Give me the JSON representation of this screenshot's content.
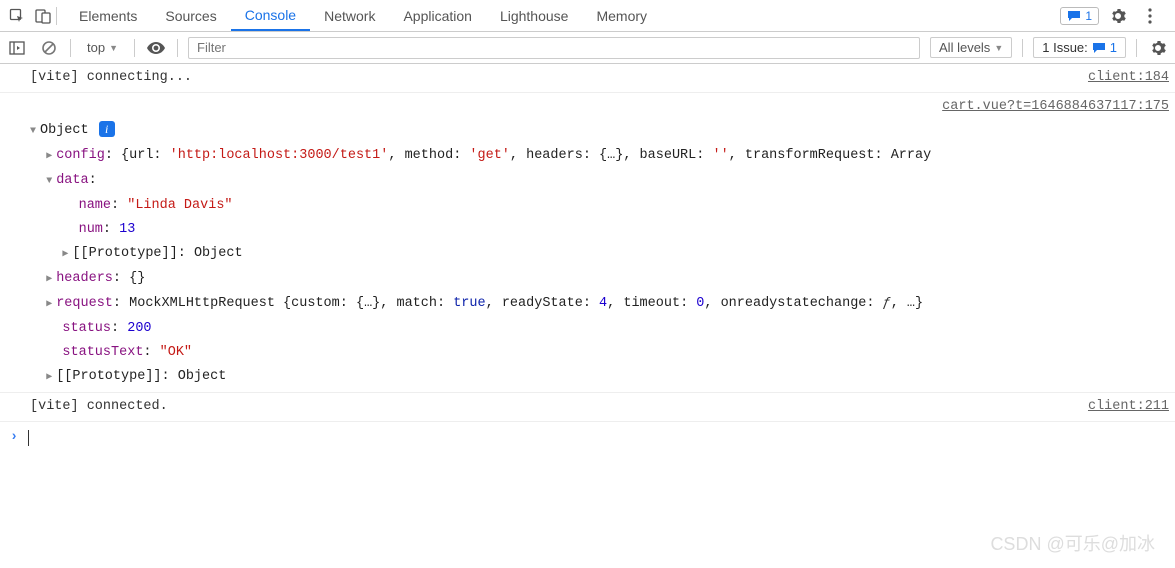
{
  "tabs": [
    "Elements",
    "Sources",
    "Console",
    "Network",
    "Application",
    "Lighthouse",
    "Memory"
  ],
  "active_tab": "Console",
  "badge_count": "1",
  "sub": {
    "context": "top",
    "filter_placeholder": "Filter",
    "levels": "All levels",
    "issues_label": "1 Issue:",
    "issues_count": "1"
  },
  "log1": {
    "text": "[vite] connecting...",
    "src": "client:184"
  },
  "obj": {
    "src": "cart.vue?t=1646884637117:175",
    "title": "Object",
    "config_k": "config",
    "config_url": "'http:localhost:3000/test1'",
    "config_method_k": "method",
    "config_method_v": "'get'",
    "config_headers_k": "headers",
    "config_headers_v": "{…}",
    "config_base_k": "baseURL",
    "config_base_v": "''",
    "config_tr_k": "transformRequest",
    "config_tr_v": "Array",
    "data_k": "data",
    "name_k": "name",
    "name_v": "\"Linda Davis\"",
    "num_k": "num",
    "num_v": "13",
    "proto_k": "[[Prototype]]",
    "proto_v": "Object",
    "headers_k": "headers",
    "headers_v": "{}",
    "request_k": "request",
    "request_v_type": "MockXMLHttpRequest",
    "req_custom_k": "custom",
    "req_custom_v": "{…}",
    "req_match_k": "match",
    "req_match_v": "true",
    "req_rs_k": "readyState",
    "req_rs_v": "4",
    "req_to_k": "timeout",
    "req_to_v": "0",
    "req_or_k": "onreadystatechange",
    "req_or_v": "ƒ",
    "req_more": "…",
    "status_k": "status",
    "status_v": "200",
    "statusText_k": "statusText",
    "statusText_v": "\"OK\""
  },
  "log2": {
    "text": "[vite] connected.",
    "src": "client:211"
  },
  "watermark": "CSDN @可乐@加冰"
}
